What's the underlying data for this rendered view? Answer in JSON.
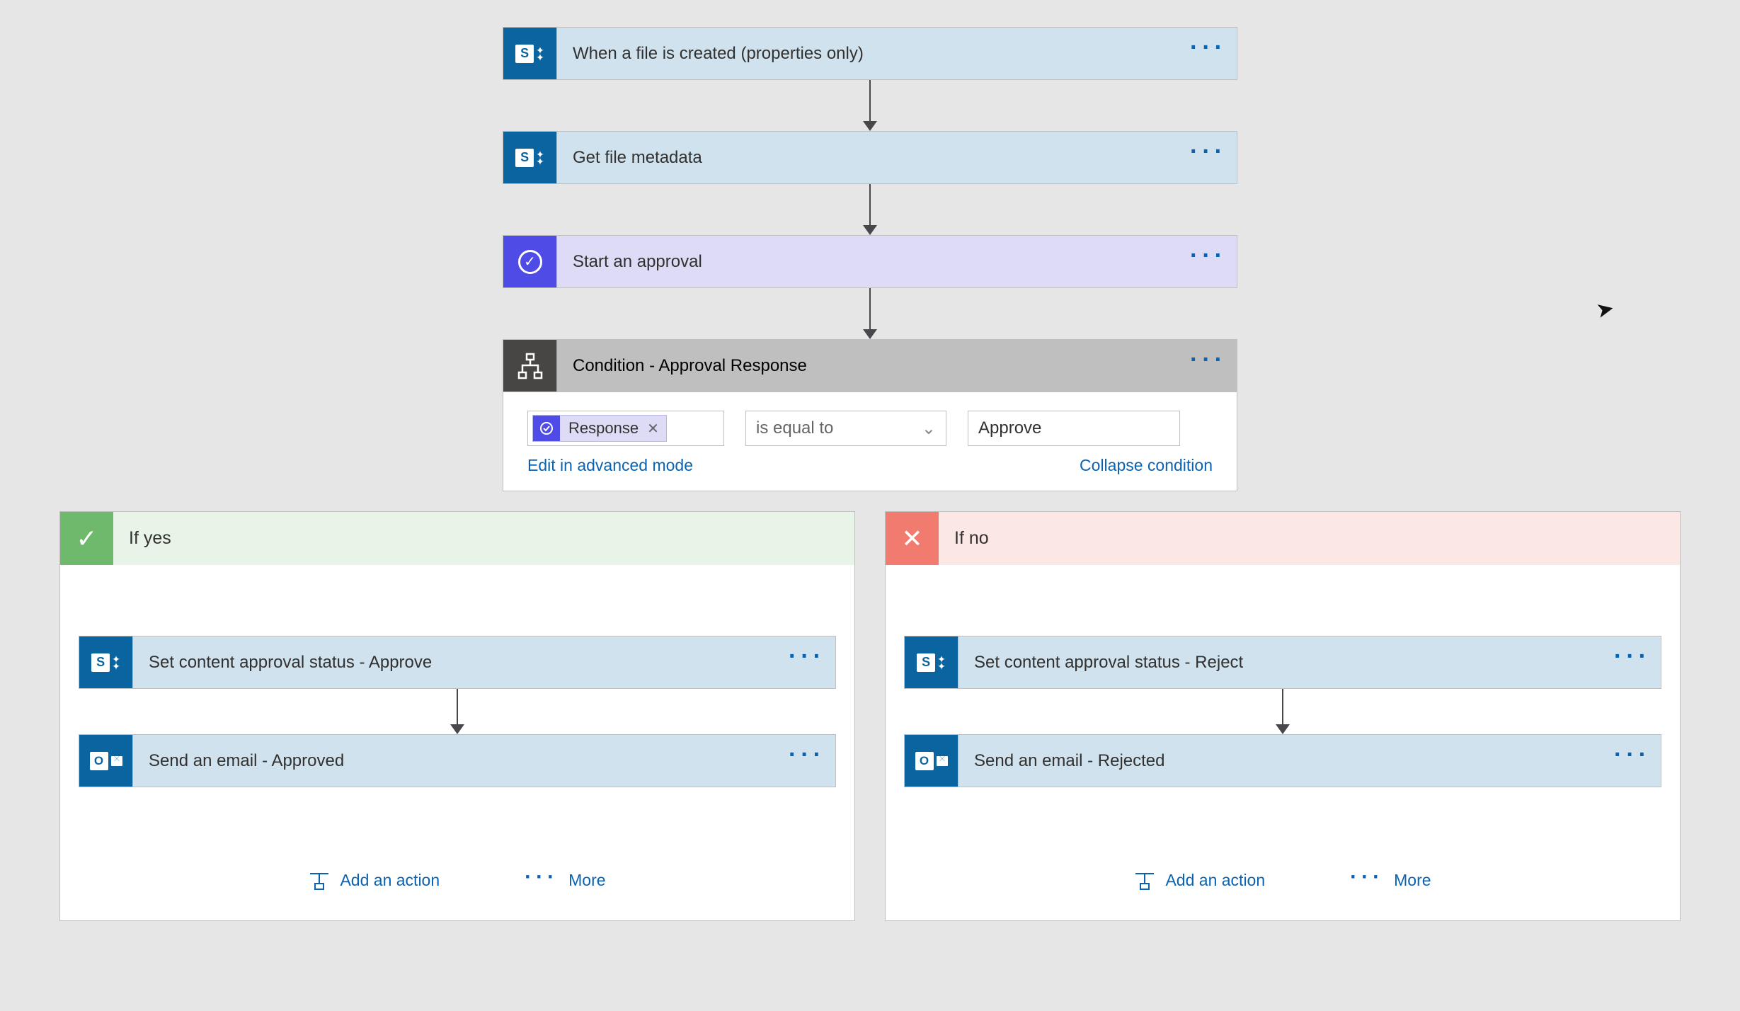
{
  "steps": {
    "s1_title": "When a file is created (properties only)",
    "s2_title": "Get file metadata",
    "s3_title": "Start an approval",
    "s4_title": "Condition - Approval Response"
  },
  "condition": {
    "token_label": "Response",
    "operator": "is equal to",
    "value": "Approve",
    "link_edit": "Edit in advanced mode",
    "link_collapse": "Collapse condition"
  },
  "branch_yes": {
    "title": "If yes",
    "step1": "Set content approval status - Approve",
    "step2": "Send an email - Approved",
    "add_action": "Add an action",
    "more": "More"
  },
  "branch_no": {
    "title": "If no",
    "step1": "Set content approval status - Reject",
    "step2": "Send an email - Rejected",
    "add_action": "Add an action",
    "more": "More"
  }
}
